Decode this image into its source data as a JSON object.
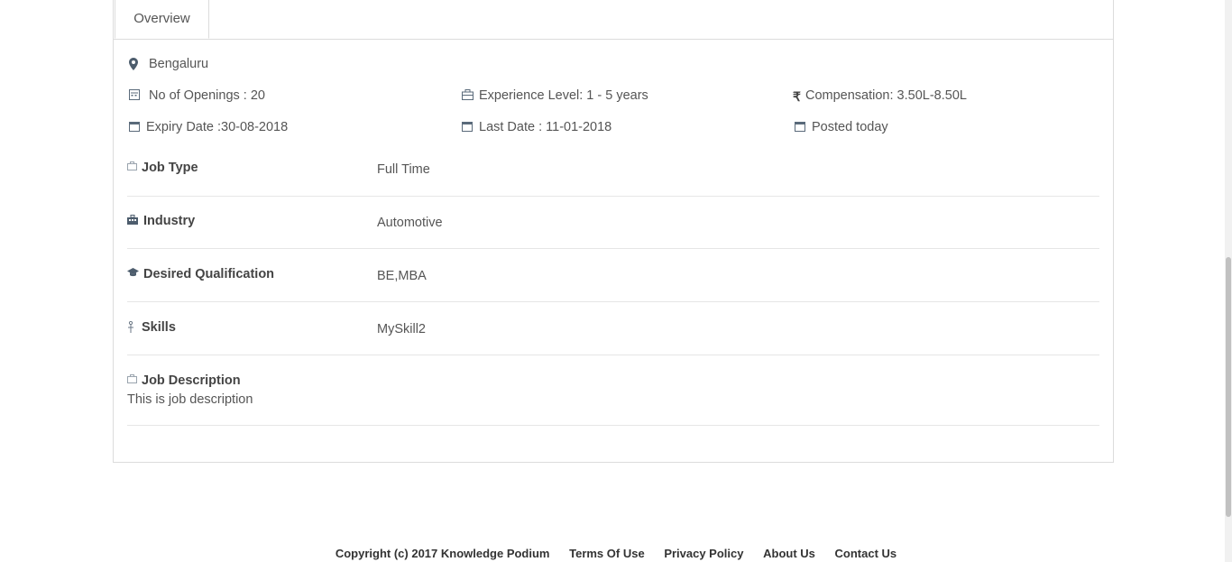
{
  "tabs": {
    "overview": "Overview"
  },
  "location": "Bengaluru",
  "meta": {
    "openings": "No of Openings : 20",
    "experience": "Experience Level: 1 - 5 years",
    "compensation": "Compensation: 3.50L-8.50L",
    "expiry": "Expiry Date :30-08-2018",
    "last_date": "Last Date : 11-01-2018",
    "posted": "Posted today"
  },
  "details": {
    "job_type": {
      "label": "Job Type",
      "value": "Full Time"
    },
    "industry": {
      "label": "Industry",
      "value": "Automotive"
    },
    "qualification": {
      "label": "Desired Qualification",
      "value": "BE,MBA"
    },
    "skills": {
      "label": "Skills",
      "value": "MySkill2"
    },
    "description": {
      "label": "Job Description",
      "value": "This is job description"
    }
  },
  "footer": {
    "copyright": "Copyright (c) 2017 Knowledge Podium",
    "links": [
      "Terms Of Use",
      "Privacy Policy",
      "About Us",
      "Contact Us"
    ]
  },
  "colors": {
    "icon": "#5a6a7a",
    "border": "#dcdcdc"
  }
}
